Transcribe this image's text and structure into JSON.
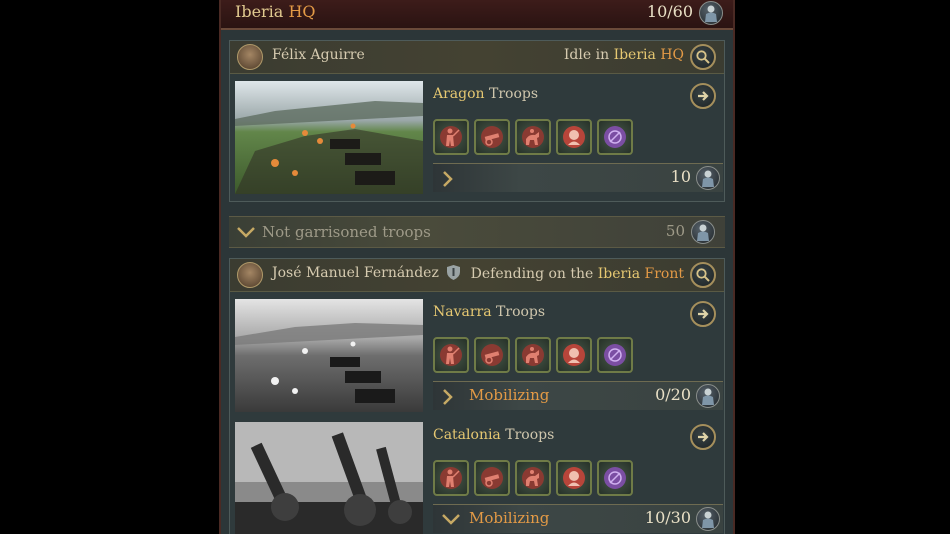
{
  "hq": {
    "title_region": "Iberia",
    "title_suffix": "HQ",
    "count": "10/60"
  },
  "armies": [
    {
      "general": "Félix Aguirre",
      "status_prefix": "Idle in",
      "status_place": "Iberia",
      "status_suffix": "HQ",
      "divisions": [
        {
          "name": "Aragon",
          "label": "Troops",
          "status": "",
          "count": "10"
        }
      ]
    },
    {
      "general": "José Manuel Fernández",
      "status_prefix": "Defending on the",
      "status_place": "Iberia",
      "status_suffix": "Front",
      "divisions": [
        {
          "name": "Navarra",
          "label": "Troops",
          "status": "Mobilizing",
          "count": "0/20"
        },
        {
          "name": "Catalonia",
          "label": "Troops",
          "status": "Mobilizing",
          "count": "10/30"
        }
      ]
    }
  ],
  "not_garrisoned": {
    "label": "Not garrisoned troops",
    "count": "50"
  },
  "unit_icons": [
    "infantry-icon",
    "artillery-icon",
    "cavalry-icon",
    "soldier-portrait-icon",
    "special-unit-icon"
  ],
  "colors": {
    "accent_gold": "#e6c872",
    "accent_orange": "#e39a46",
    "unit_red": "#b8453a",
    "unit_purple": "#8a5ab0"
  }
}
